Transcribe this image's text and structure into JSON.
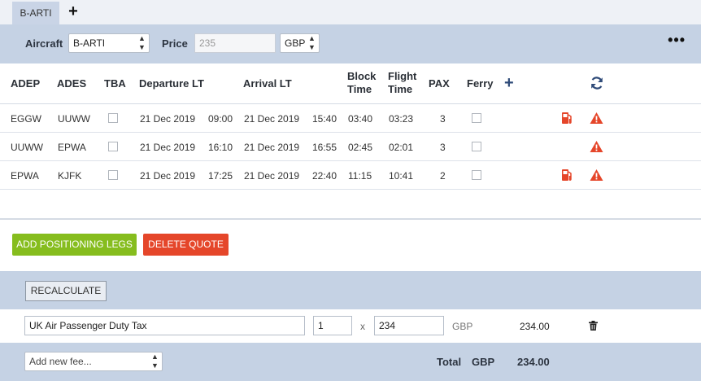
{
  "tabs": {
    "active": "B-ARTI",
    "add_label": "+"
  },
  "toolbar": {
    "aircraft_label": "Aircraft",
    "aircraft_value": "B-ARTI",
    "price_label": "Price",
    "price_placeholder": "235",
    "currency_value": "GBP",
    "more_label": "•••"
  },
  "table": {
    "headers": {
      "adep": "ADEP",
      "ades": "ADES",
      "tba": "TBA",
      "departure": "Departure LT",
      "arrival": "Arrival LT",
      "block1": "Block",
      "block2": "Time",
      "flight1": "Flight",
      "flight2": "Time",
      "pax": "PAX",
      "ferry": "Ferry",
      "add": "+"
    },
    "rows": [
      {
        "adep": "EGGW",
        "ades": "UUWW",
        "dep_date": "21 Dec 2019",
        "dep_time": "09:00",
        "arr_date": "21 Dec 2019",
        "arr_time": "15:40",
        "block": "03:40",
        "flight": "03:23",
        "pax": "3",
        "fuel_icon": "fuel-pump-icon",
        "warn_icon": "warning-icon"
      },
      {
        "adep": "UUWW",
        "ades": "EPWA",
        "dep_date": "21 Dec 2019",
        "dep_time": "16:10",
        "arr_date": "21 Dec 2019",
        "arr_time": "16:55",
        "block": "02:45",
        "flight": "02:01",
        "pax": "3",
        "warn_icon": "warning-icon"
      },
      {
        "adep": "EPWA",
        "ades": "KJFK",
        "dep_date": "21 Dec 2019",
        "dep_time": "17:25",
        "arr_date": "21 Dec 2019",
        "arr_time": "22:40",
        "block": "11:15",
        "flight": "10:41",
        "pax": "2",
        "fuel_icon": "fuel-pump-icon",
        "warn_icon": "warning-icon"
      }
    ]
  },
  "actions": {
    "add_positioning": "ADD POSITIONING LEGS",
    "delete_quote": "DELETE QUOTE"
  },
  "recalculate_label": "RECALCULATE",
  "fees": [
    {
      "name": "UK Air Passenger Duty Tax",
      "qty": "1",
      "times": "x",
      "unit_price": "234",
      "currency": "GBP",
      "amount": "234.00"
    }
  ],
  "footer": {
    "add_fee_placeholder": "Add new fee...",
    "total_label": "Total",
    "total_currency": "GBP",
    "total_amount": "234.00"
  },
  "colors": {
    "band": "#c5d2e4",
    "green": "#86bd1e",
    "red": "#e5462a",
    "warn": "#e5462a",
    "navy": "#2e4a78"
  }
}
